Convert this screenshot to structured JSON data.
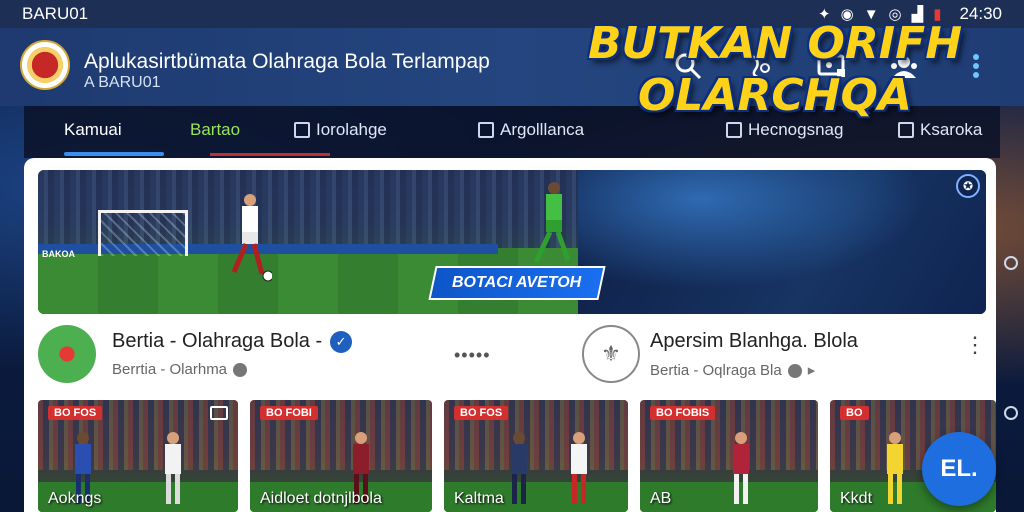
{
  "status_bar": {
    "carrier": "BARU01",
    "time": "24:30"
  },
  "app_bar": {
    "title": "Aplukasirtbümata Olahraga Bola Terlampap",
    "subtitle": "A BARU01"
  },
  "tabs": [
    {
      "label": "Kamuai"
    },
    {
      "label": "Bartao"
    },
    {
      "label": "Iorolahge"
    },
    {
      "label": "Argolllanca"
    },
    {
      "label": "Hecnogsnag"
    },
    {
      "label": "Ksaroka"
    }
  ],
  "banner": {
    "headline": "BUTKAN ORIFH OLARCHQA",
    "tag": "BOTACI AVETOH",
    "stadium_board": "BAKOA"
  },
  "channels": [
    {
      "title": "Bertia - Olahraga Bola -",
      "subtitle": "Berrtia - Olarhma"
    },
    {
      "title": "Apersim Blanhga. Blola",
      "subtitle": "Bertia - Oqlraga Bla"
    }
  ],
  "thumbnails": [
    {
      "badge": "BO FOS",
      "caption": "Aokngs"
    },
    {
      "badge": "BO FOBI",
      "caption": "Aidloet dotnjlbola"
    },
    {
      "badge": "BO FOS",
      "caption": "Kaltma"
    },
    {
      "badge": "BO FOBIS",
      "caption": "AB"
    },
    {
      "badge": "BO",
      "caption": "Kkdt"
    }
  ],
  "fab": {
    "label": "EL."
  },
  "colors": {
    "status_bar": "#1d2f55",
    "app_bar": "#24457f",
    "tab_indicator": "#3a8ef0",
    "active_green_tab": "#9be35b",
    "headline_yellow": "#ffd21a",
    "fab": "#1e6ee0"
  }
}
